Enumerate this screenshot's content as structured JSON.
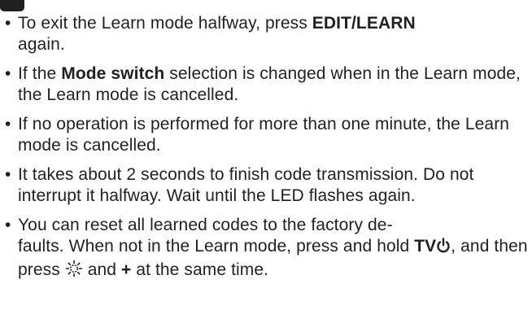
{
  "notes": [
    {
      "bullet": "•",
      "text_1": "To exit the Learn mode halfway, press ",
      "bold_1": "EDIT/LEARN",
      "text_2": " again."
    },
    {
      "bullet": "•",
      "text_1": "If the ",
      "bold_1": "Mode switch",
      "text_2": " selection is changed when in the Learn mode, the Learn mode is cancelled."
    },
    {
      "bullet": "•",
      "text_1": "If no operation is performed for more than one minute, the Learn mode is cancelled."
    },
    {
      "bullet": "•",
      "text_1": "It takes about 2 seconds to finish code transmission. Do not interrupt it halfway. Wait until the LED flashes again."
    },
    {
      "bullet": "•",
      "text_1": "You can reset all learned codes to the factory de-",
      "text_1b": "faults. When not in the Learn mode, press and hold ",
      "bold_1": "TV",
      "power_icon": "power-icon",
      "text_2": ", and then press ",
      "brightness_icon": "brightness-icon",
      "text_3": " and ",
      "bold_2": "+",
      "text_4": " at the same time."
    }
  ]
}
